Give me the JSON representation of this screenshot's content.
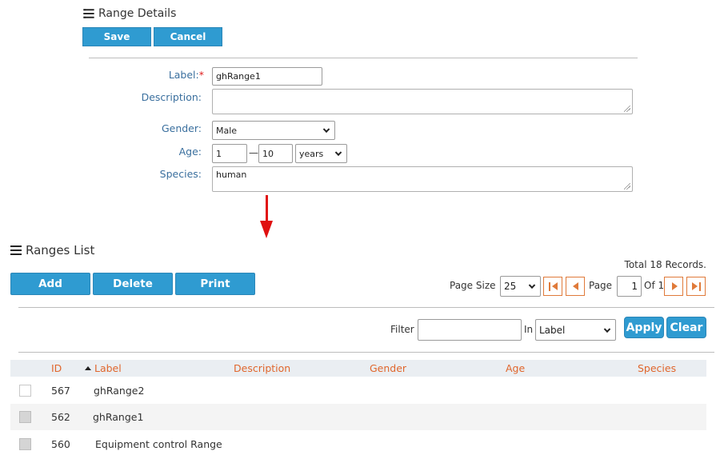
{
  "range_details": {
    "title": "Range Details",
    "save_label": "Save",
    "cancel_label": "Cancel",
    "fields": {
      "label_label": "Label:",
      "label_required": "*",
      "label_value": "ghRange1",
      "description_label": "Description:",
      "description_value": "",
      "gender_label": "Gender:",
      "gender_value": "Male",
      "age_label": "Age:",
      "age_from": "1",
      "age_separator": "—",
      "age_to": "10",
      "age_unit": "years",
      "species_label": "Species:",
      "species_value": "human"
    }
  },
  "ranges_list": {
    "title": "Ranges List",
    "add_label": "Add",
    "delete_label": "Delete",
    "print_label": "Print",
    "total_records": "Total 18 Records.",
    "pager": {
      "page_size_label": "Page Size",
      "page_size_value": "25",
      "page_label": "Page",
      "page_value": "1",
      "of_label": "Of 1"
    },
    "filter": {
      "filter_label": "Filter",
      "filter_value": "",
      "in_label": "In",
      "in_value": "Label",
      "apply_label": "Apply",
      "clear_label": "Clear"
    },
    "columns": [
      "ID",
      "Label",
      "Description",
      "Gender",
      "Age",
      "Species"
    ],
    "rows": [
      {
        "id": "567",
        "label": "ghRange2",
        "description": "",
        "gender": "",
        "age": "",
        "species": ""
      },
      {
        "id": "562",
        "label": "ghRange1",
        "description": "",
        "gender": "",
        "age": "",
        "species": ""
      },
      {
        "id": "560",
        "label": "Equipment control Range",
        "description": "",
        "gender": "",
        "age": "",
        "species": ""
      }
    ]
  },
  "colors": {
    "button_blue": "#2f9bd1",
    "label_blue": "#3a6f9e",
    "column_orange": "#e0662c",
    "arrow_red": "#e01010",
    "pager_orange": "#e07a3a"
  },
  "icons": [
    "list-icon",
    "sort-asc-icon",
    "first-page-icon",
    "prev-page-icon",
    "next-page-icon",
    "last-page-icon",
    "chevron-down-icon",
    "resize-grip-icon",
    "down-arrow-icon"
  ]
}
